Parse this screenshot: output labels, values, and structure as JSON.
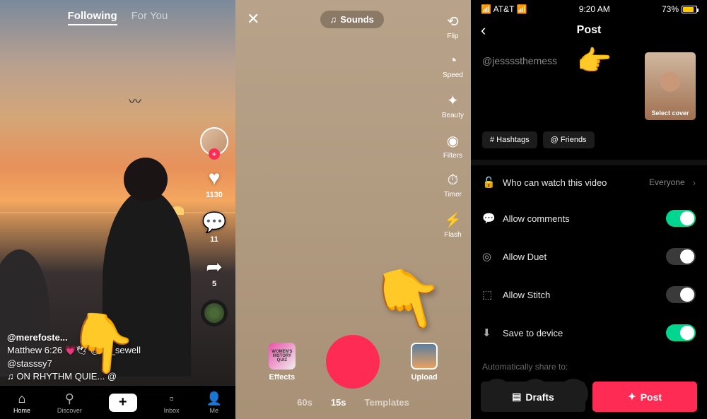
{
  "s1": {
    "tabs": {
      "following": "Following",
      "forYou": "For You"
    },
    "rail": {
      "likes": "1130",
      "comments": "11",
      "shares": "5"
    },
    "meta": {
      "user": "@merefoste...",
      "caption": "Matthew 6:26 💗🕊 @... _sewell",
      "mention": "@stasssy7",
      "sound": "♫  ON RHYTHM   QUIE... @"
    },
    "nav": {
      "home": "Home",
      "discover": "Discover",
      "inbox": "Inbox",
      "me": "Me"
    }
  },
  "s2": {
    "sounds": "Sounds",
    "side": {
      "flip": "Flip",
      "speed": "Speed",
      "beauty": "Beauty",
      "filters": "Filters",
      "timer": "Timer",
      "flash": "Flash"
    },
    "bot": {
      "effects": "Effects",
      "upload": "Upload"
    },
    "dur": {
      "d60": "60s",
      "d15": "15s",
      "tmpl": "Templates"
    }
  },
  "s3": {
    "status": {
      "carrier": "AT&T",
      "time": "9:20 AM",
      "battery": "73%"
    },
    "title": "Post",
    "caption": "@jessssthemess",
    "cover": "Select cover",
    "chips": {
      "hash": "# Hashtags",
      "friends": "@ Friends"
    },
    "settings": {
      "privacy": {
        "label": "Who can watch this video",
        "value": "Everyone"
      },
      "comments": "Allow comments",
      "duet": "Allow Duet",
      "stitch": "Allow Stitch",
      "save": "Save to device"
    },
    "auto": "Automatically share to:",
    "footer": {
      "drafts": "Drafts",
      "post": "Post"
    }
  }
}
